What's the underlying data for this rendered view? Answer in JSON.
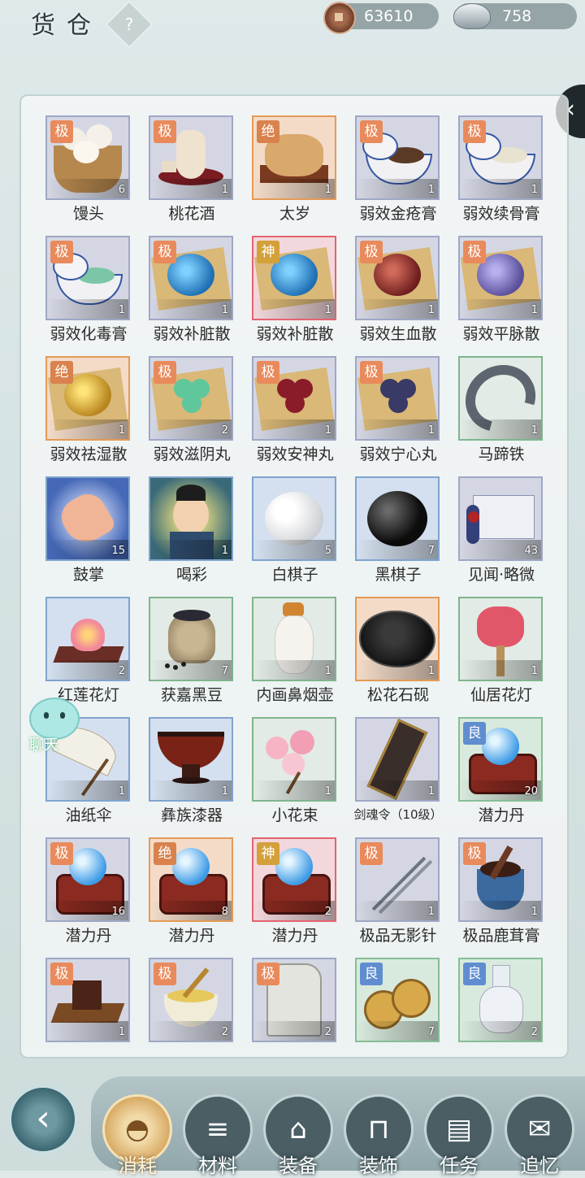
{
  "header": {
    "title": "货仓",
    "help_label": "?",
    "copper": "63610",
    "silver": "758"
  },
  "side_tab_label": "‹",
  "chat_label": "聊天",
  "items": [
    {
      "name": "馒头",
      "badge": "极",
      "count": "6",
      "rarity": "ji",
      "pic": "buns"
    },
    {
      "name": "桃花酒",
      "badge": "极",
      "count": "1",
      "rarity": "ji",
      "pic": "wine"
    },
    {
      "name": "太岁",
      "badge": "绝",
      "count": "1",
      "rarity": "jue",
      "pic": "taisui"
    },
    {
      "name": "弱效金疮膏",
      "badge": "极",
      "count": "1",
      "rarity": "ji",
      "pic": "jar-dark"
    },
    {
      "name": "弱效续骨膏",
      "badge": "极",
      "count": "1",
      "rarity": "ji",
      "pic": "jar-light"
    },
    {
      "name": "弱效化毒膏",
      "badge": "极",
      "count": "1",
      "rarity": "ji",
      "pic": "jar-green"
    },
    {
      "name": "弱效补脏散",
      "badge": "极",
      "count": "1",
      "rarity": "ji",
      "pic": "powder-blue"
    },
    {
      "name": "弱效补脏散",
      "badge": "神",
      "count": "1",
      "rarity": "shen",
      "pic": "powder-blue"
    },
    {
      "name": "弱效生血散",
      "badge": "极",
      "count": "1",
      "rarity": "ji",
      "pic": "powder-red"
    },
    {
      "name": "弱效平脉散",
      "badge": "极",
      "count": "1",
      "rarity": "ji",
      "pic": "powder-purple"
    },
    {
      "name": "弱效祛湿散",
      "badge": "绝",
      "count": "1",
      "rarity": "jue",
      "pic": "powder-gold"
    },
    {
      "name": "弱效滋阴丸",
      "badge": "极",
      "count": "2",
      "rarity": "ji",
      "pic": "pills-green"
    },
    {
      "name": "弱效安神丸",
      "badge": "极",
      "count": "1",
      "rarity": "ji",
      "pic": "pills-red"
    },
    {
      "name": "弱效宁心丸",
      "badge": "极",
      "count": "1",
      "rarity": "ji",
      "pic": "pills-navy"
    },
    {
      "name": "马蹄铁",
      "badge": "",
      "count": "1",
      "rarity": "none",
      "pic": "horseshoe"
    },
    {
      "name": "鼓掌",
      "badge": "",
      "count": "15",
      "rarity": "blue",
      "pic": "clap"
    },
    {
      "name": "喝彩",
      "badge": "",
      "count": "1",
      "rarity": "blue",
      "pic": "cheer"
    },
    {
      "name": "白棋子",
      "badge": "",
      "count": "5",
      "rarity": "blue",
      "pic": "white-stone"
    },
    {
      "name": "黑棋子",
      "badge": "",
      "count": "7",
      "rarity": "blue",
      "pic": "black-stone"
    },
    {
      "name": "见闻·略微",
      "badge": "",
      "count": "43",
      "rarity": "ji",
      "pic": "scroll"
    },
    {
      "name": "红莲花灯",
      "badge": "",
      "count": "2",
      "rarity": "blue",
      "pic": "lotus"
    },
    {
      "name": "获嘉黑豆",
      "badge": "",
      "count": "7",
      "rarity": "none",
      "pic": "beans"
    },
    {
      "name": "内画鼻烟壶",
      "badge": "",
      "count": "1",
      "rarity": "none",
      "pic": "snuff"
    },
    {
      "name": "松花石砚",
      "badge": "",
      "count": "1",
      "rarity": "jue",
      "pic": "inkstone"
    },
    {
      "name": "仙居花灯",
      "badge": "",
      "count": "1",
      "rarity": "none",
      "pic": "lantern"
    },
    {
      "name": "油纸伞",
      "badge": "",
      "count": "1",
      "rarity": "blue",
      "pic": "umbrella"
    },
    {
      "name": "彝族漆器",
      "badge": "",
      "count": "1",
      "rarity": "blue",
      "pic": "lacquer"
    },
    {
      "name": "小花束",
      "badge": "",
      "count": "1",
      "rarity": "none",
      "pic": "flowers"
    },
    {
      "name": "剑魂令（10级）",
      "badge": "",
      "count": "1",
      "rarity": "ji",
      "pic": "token"
    },
    {
      "name": "潜力丹",
      "badge": "良",
      "count": "20",
      "rarity": "liang",
      "pic": "orb"
    },
    {
      "name": "潜力丹",
      "badge": "极",
      "count": "16",
      "rarity": "ji",
      "pic": "orb"
    },
    {
      "name": "潜力丹",
      "badge": "绝",
      "count": "8",
      "rarity": "jue",
      "pic": "orb"
    },
    {
      "name": "潜力丹",
      "badge": "神",
      "count": "2",
      "rarity": "shen",
      "pic": "orb"
    },
    {
      "name": "极品无影针",
      "badge": "极",
      "count": "1",
      "rarity": "ji",
      "pic": "needles"
    },
    {
      "name": "极品鹿茸膏",
      "badge": "极",
      "count": "1",
      "rarity": "ji",
      "pic": "mortar"
    },
    {
      "name": "",
      "badge": "极",
      "count": "1",
      "rarity": "ji",
      "pic": "chocolate"
    },
    {
      "name": "",
      "badge": "极",
      "count": "2",
      "rarity": "ji",
      "pic": "bowl"
    },
    {
      "name": "",
      "badge": "极",
      "count": "2",
      "rarity": "ji",
      "pic": "tablet"
    },
    {
      "name": "",
      "badge": "良",
      "count": "7",
      "rarity": "liang",
      "pic": "coins"
    },
    {
      "name": "",
      "badge": "良",
      "count": "2",
      "rarity": "liang",
      "pic": "vase"
    }
  ],
  "nav": {
    "back_label": "‹",
    "tabs": [
      {
        "label": "消耗",
        "icon": "bowl-icon",
        "active": true
      },
      {
        "label": "材料",
        "icon": "logs-icon",
        "active": false
      },
      {
        "label": "装备",
        "icon": "robe-icon",
        "active": false
      },
      {
        "label": "装饰",
        "icon": "bridge-icon",
        "active": false
      },
      {
        "label": "任务",
        "icon": "book-icon",
        "active": false
      },
      {
        "label": "追忆",
        "icon": "letter-icon",
        "active": false
      }
    ]
  }
}
